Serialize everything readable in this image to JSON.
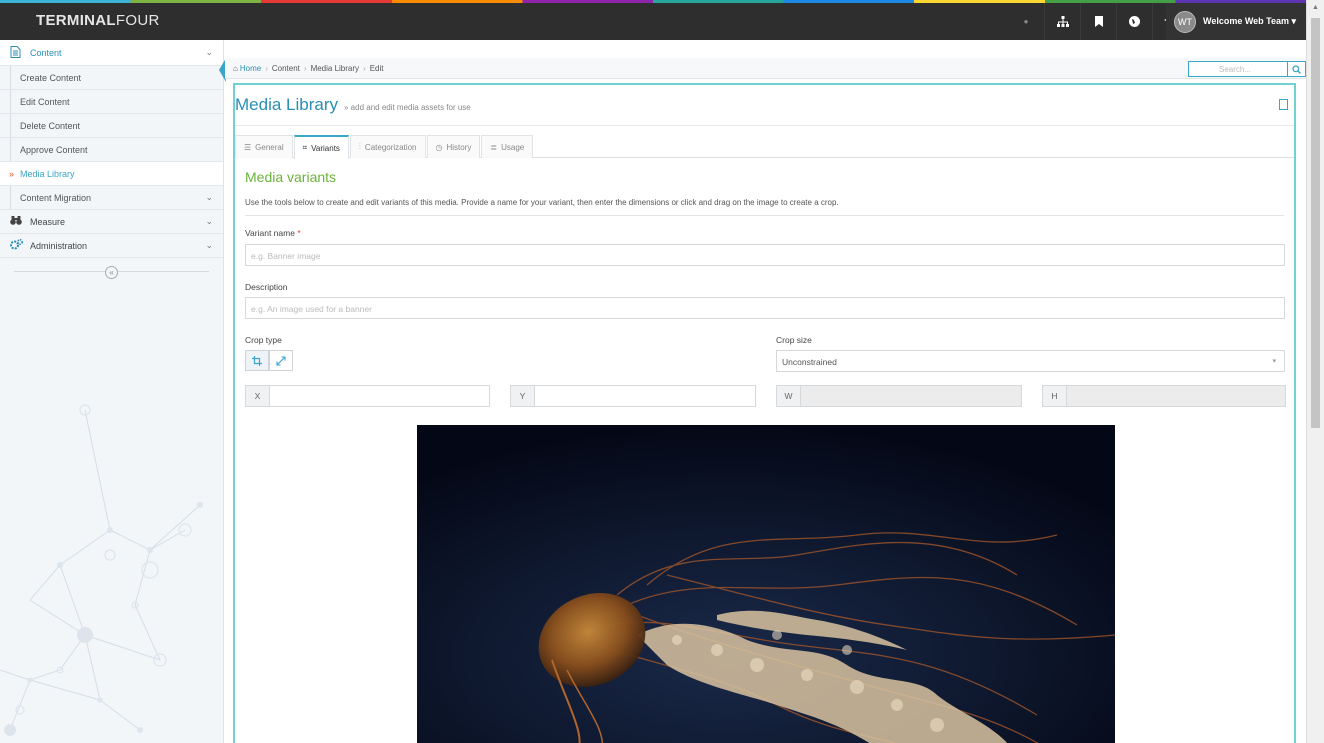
{
  "app": {
    "brand_bold": "TERMINAL",
    "brand_light": "FOUR",
    "user": {
      "initials": "WT",
      "name": "Welcome Web Team ▾"
    },
    "top_icons": [
      "status-dot-icon",
      "sitemap-icon",
      "bookmark-icon",
      "globe-icon",
      "graduation-cap-icon"
    ]
  },
  "sidebar": {
    "content_label": "Content",
    "items": [
      {
        "label": "Create Content"
      },
      {
        "label": "Edit Content"
      },
      {
        "label": "Delete Content"
      },
      {
        "label": "Approve Content"
      },
      {
        "label": "Media Library"
      },
      {
        "label": "Content Migration"
      }
    ],
    "measure_label": "Measure",
    "administration_label": "Administration"
  },
  "breadcrumb": {
    "home": "Home",
    "items": [
      "Content",
      "Media Library",
      "Edit"
    ]
  },
  "search": {
    "placeholder": "Search..."
  },
  "page": {
    "title": "Media Library",
    "subtitle": "» add and edit media assets for use"
  },
  "tabs": [
    {
      "label": "General"
    },
    {
      "label": "Variants"
    },
    {
      "label": "Categorization"
    },
    {
      "label": "History"
    },
    {
      "label": "Usage"
    }
  ],
  "variants": {
    "heading": "Media variants",
    "help": "Use the tools below to create and edit variants of this media. Provide a name for your variant, then enter the dimensions or click and drag on the image to create a crop.",
    "name_label": "Variant name",
    "required_mark": "*",
    "name_placeholder": "e.g. Banner image",
    "desc_label": "Description",
    "desc_placeholder": "e.g. An image used for a banner",
    "crop_type_label": "Crop type",
    "crop_size_label": "Crop size",
    "crop_size_value": "Unconstrained",
    "x_label": "X",
    "y_label": "Y",
    "w_label": "W",
    "h_label": "H"
  }
}
